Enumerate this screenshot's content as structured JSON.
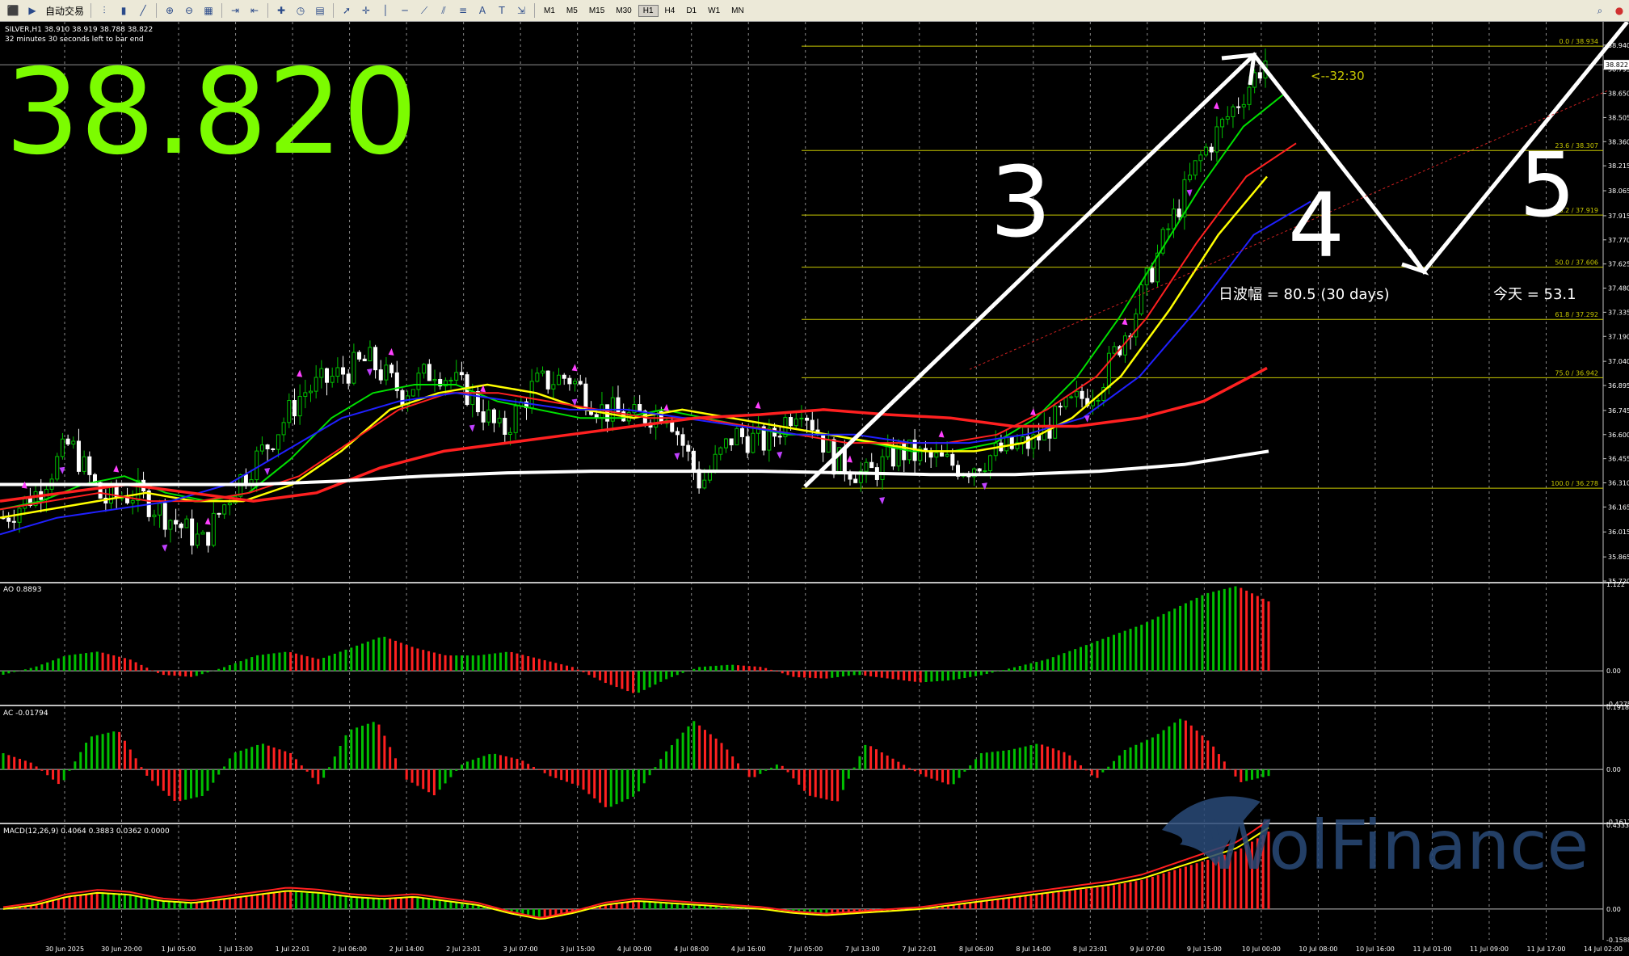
{
  "toolbar": {
    "auto_trading_label": "自动交易",
    "timeframes": [
      "M1",
      "M5",
      "M15",
      "M30",
      "H1",
      "H4",
      "D1",
      "W1",
      "MN"
    ],
    "text_tool_label": "A"
  },
  "header": {
    "symbol_line": "SILVER,H1  38.910 38.919 38.788 38.822",
    "countdown_line": "32 minutes 30 seconds left to bar end",
    "big_price": "38.820",
    "bar_timer": "<--32:30"
  },
  "colors": {
    "big_price": "#7cfc00",
    "bull": "#00c000",
    "bear": "#ff2020",
    "ma_green": "#00e000",
    "ma_yellow": "#ffff00",
    "ma_red": "#ff2020",
    "ma_blue": "#2020ff",
    "ma_white": "#ffffff",
    "fib": "#c8c800",
    "arrow_up": "#ff40ff",
    "arrow_down": "#c040ff",
    "macd_signal": "#ffff00"
  },
  "chart_data": [
    {
      "type": "candlestick",
      "title": "SILVER,H1",
      "ylim": [
        35.72,
        39.08
      ],
      "yticks": [
        "38.940",
        "38.795",
        "38.650",
        "38.505",
        "38.360",
        "38.215",
        "38.065",
        "37.915",
        "37.770",
        "37.625",
        "37.480",
        "37.335",
        "37.190",
        "37.040",
        "36.895",
        "36.745",
        "36.600",
        "36.455",
        "36.310",
        "36.165",
        "36.015",
        "35.865",
        "35.720"
      ],
      "current_price": "38.822",
      "xticks": [
        "30 Jun 2025",
        "30 Jun 20:00",
        "1 Jul 05:00",
        "1 Jul 13:00",
        "1 Jul 22:01",
        "2 Jul 06:00",
        "2 Jul 14:00",
        "2 Jul 23:01",
        "3 Jul 07:00",
        "3 Jul 15:00",
        "4 Jul 00:00",
        "4 Jul 08:00",
        "4 Jul 16:00",
        "7 Jul 05:00",
        "7 Jul 13:00",
        "7 Jul 22:01",
        "8 Jul 06:00",
        "8 Jul 14:00",
        "8 Jul 23:01",
        "9 Jul 07:00",
        "9 Jul 15:00",
        "10 Jul 00:00",
        "10 Jul 08:00",
        "10 Jul 16:00",
        "11 Jul 01:00",
        "11 Jul 09:00",
        "11 Jul 17:00",
        "14 Jul 02:00"
      ],
      "close_path": [
        36.1,
        36.25,
        36.55,
        36.2,
        36.25,
        36.1,
        35.95,
        36.3,
        36.55,
        36.85,
        36.95,
        37.05,
        36.85,
        37.0,
        36.85,
        36.6,
        36.9,
        36.95,
        36.75,
        36.7,
        36.75,
        36.3,
        36.6,
        36.55,
        36.8,
        36.45,
        36.35,
        36.5,
        36.45,
        36.4,
        36.5,
        36.55,
        36.75,
        36.9,
        37.3,
        37.8,
        38.25,
        38.55,
        38.85
      ],
      "fibonacci": [
        {
          "label": "0.0  /  38.934",
          "value": 38.934
        },
        {
          "label": "23.6  /  38.307",
          "value": 38.307
        },
        {
          "label": "38.2  /  37.919",
          "value": 37.919
        },
        {
          "label": "50.0  /  37.606",
          "value": 37.606
        },
        {
          "label": "61.8  /  37.292",
          "value": 37.292
        },
        {
          "label": "75.0  /  36.942",
          "value": 36.942
        },
        {
          "label": "100.0  /  36.278",
          "value": 36.278
        }
      ],
      "annotations": {
        "wave_labels": [
          "3",
          "4",
          "5"
        ],
        "volatility_text": "日波幅 = 80.5   (30 days)",
        "today_text": "今天 = 53.1"
      },
      "moving_averages": [
        {
          "color": "green",
          "path": [
            36.15,
            36.2,
            36.3,
            36.35,
            36.25,
            36.2,
            36.25,
            36.45,
            36.7,
            36.85,
            36.9,
            36.9,
            36.8,
            36.75,
            36.7,
            36.7,
            36.75,
            36.7,
            36.65,
            36.6,
            36.6,
            36.55,
            36.5,
            36.5,
            36.55,
            36.7,
            36.95,
            37.3,
            37.7,
            38.1,
            38.45,
            38.65
          ]
        },
        {
          "color": "yellow",
          "path": [
            36.1,
            36.15,
            36.2,
            36.25,
            36.2,
            36.2,
            36.3,
            36.5,
            36.75,
            36.85,
            36.9,
            36.85,
            36.75,
            36.7,
            36.75,
            36.7,
            36.65,
            36.6,
            36.55,
            36.5,
            36.5,
            36.55,
            36.7,
            36.95,
            37.35,
            37.8,
            38.15
          ]
        },
        {
          "color": "red_fast",
          "path": [
            36.15,
            36.2,
            36.25,
            36.2,
            36.2,
            36.25,
            36.35,
            36.55,
            36.75,
            36.85,
            36.85,
            36.8,
            36.75,
            36.7,
            36.7,
            36.65,
            36.6,
            36.55,
            36.55,
            36.55,
            36.6,
            36.75,
            36.95,
            37.3,
            37.75,
            38.15,
            38.35
          ]
        },
        {
          "color": "blue",
          "path": [
            36.0,
            36.1,
            36.15,
            36.2,
            36.3,
            36.5,
            36.7,
            36.8,
            36.85,
            36.8,
            36.75,
            36.75,
            36.7,
            36.65,
            36.6,
            36.6,
            36.55,
            36.55,
            36.6,
            36.7,
            36.95,
            37.35,
            37.8,
            38.0
          ]
        },
        {
          "color": "red_slow",
          "path": [
            36.2,
            36.25,
            36.3,
            36.25,
            36.2,
            36.25,
            36.4,
            36.5,
            36.55,
            36.6,
            36.65,
            36.7,
            36.72,
            36.75,
            36.72,
            36.7,
            36.65,
            36.65,
            36.7,
            36.8,
            37.0
          ]
        },
        {
          "color": "white",
          "path": [
            36.3,
            36.3,
            36.3,
            36.3,
            36.32,
            36.35,
            36.37,
            36.38,
            36.38,
            36.38,
            36.37,
            36.36,
            36.36,
            36.38,
            36.42,
            36.5
          ]
        }
      ]
    },
    {
      "type": "bar",
      "title": "AO 0.8893",
      "ylim": [
        -0.4275,
        1.122
      ],
      "yticks": [
        "1.122",
        "0.00",
        "-0.4275"
      ],
      "values": [
        -0.05,
        0.05,
        0.2,
        0.25,
        0.15,
        -0.05,
        -0.08,
        0.05,
        0.2,
        0.25,
        0.15,
        0.3,
        0.45,
        0.3,
        0.2,
        0.2,
        0.25,
        0.15,
        0.05,
        -0.15,
        -0.3,
        -0.1,
        0.05,
        0.08,
        0.05,
        -0.08,
        -0.1,
        -0.05,
        -0.1,
        -0.15,
        -0.12,
        -0.05,
        0.05,
        0.15,
        0.3,
        0.45,
        0.6,
        0.8,
        1.0,
        1.1,
        0.9
      ]
    },
    {
      "type": "bar",
      "title": "AC -0.01794",
      "ylim": [
        -0.16114,
        0.19181
      ],
      "yticks": [
        "0.19181",
        "0.00",
        "-0.16114"
      ],
      "values": [
        0.05,
        0.02,
        -0.05,
        0.1,
        0.12,
        -0.02,
        -0.1,
        -0.08,
        0.05,
        0.08,
        0.05,
        -0.05,
        0.12,
        0.15,
        -0.03,
        -0.08,
        0.02,
        0.05,
        0.03,
        -0.02,
        -0.05,
        -0.12,
        -0.08,
        0.05,
        0.15,
        0.08,
        -0.03,
        0.02,
        -0.08,
        -0.1,
        0.08,
        0.03,
        -0.02,
        -0.05,
        0.05,
        0.06,
        0.08,
        0.05,
        -0.03,
        0.06,
        0.1,
        0.16,
        0.08,
        -0.04,
        -0.02
      ]
    },
    {
      "type": "bar",
      "title": "MACD(12,26,9) 0.4064 0.3883 0.0362 0.0000",
      "ylim": [
        -0.1588,
        0.4333
      ],
      "yticks": [
        "0.4333",
        "0.00",
        "-0.1588"
      ],
      "values": [
        0.0,
        0.02,
        0.06,
        0.08,
        0.07,
        0.04,
        0.03,
        0.05,
        0.07,
        0.09,
        0.08,
        0.06,
        0.05,
        0.06,
        0.04,
        0.02,
        -0.02,
        -0.05,
        -0.02,
        0.02,
        0.04,
        0.03,
        0.02,
        0.01,
        0.0,
        -0.02,
        -0.03,
        -0.02,
        -0.01,
        0.0,
        0.02,
        0.04,
        0.06,
        0.08,
        0.1,
        0.12,
        0.15,
        0.2,
        0.25,
        0.3,
        0.4
      ]
    }
  ],
  "watermark": "WolFinance"
}
